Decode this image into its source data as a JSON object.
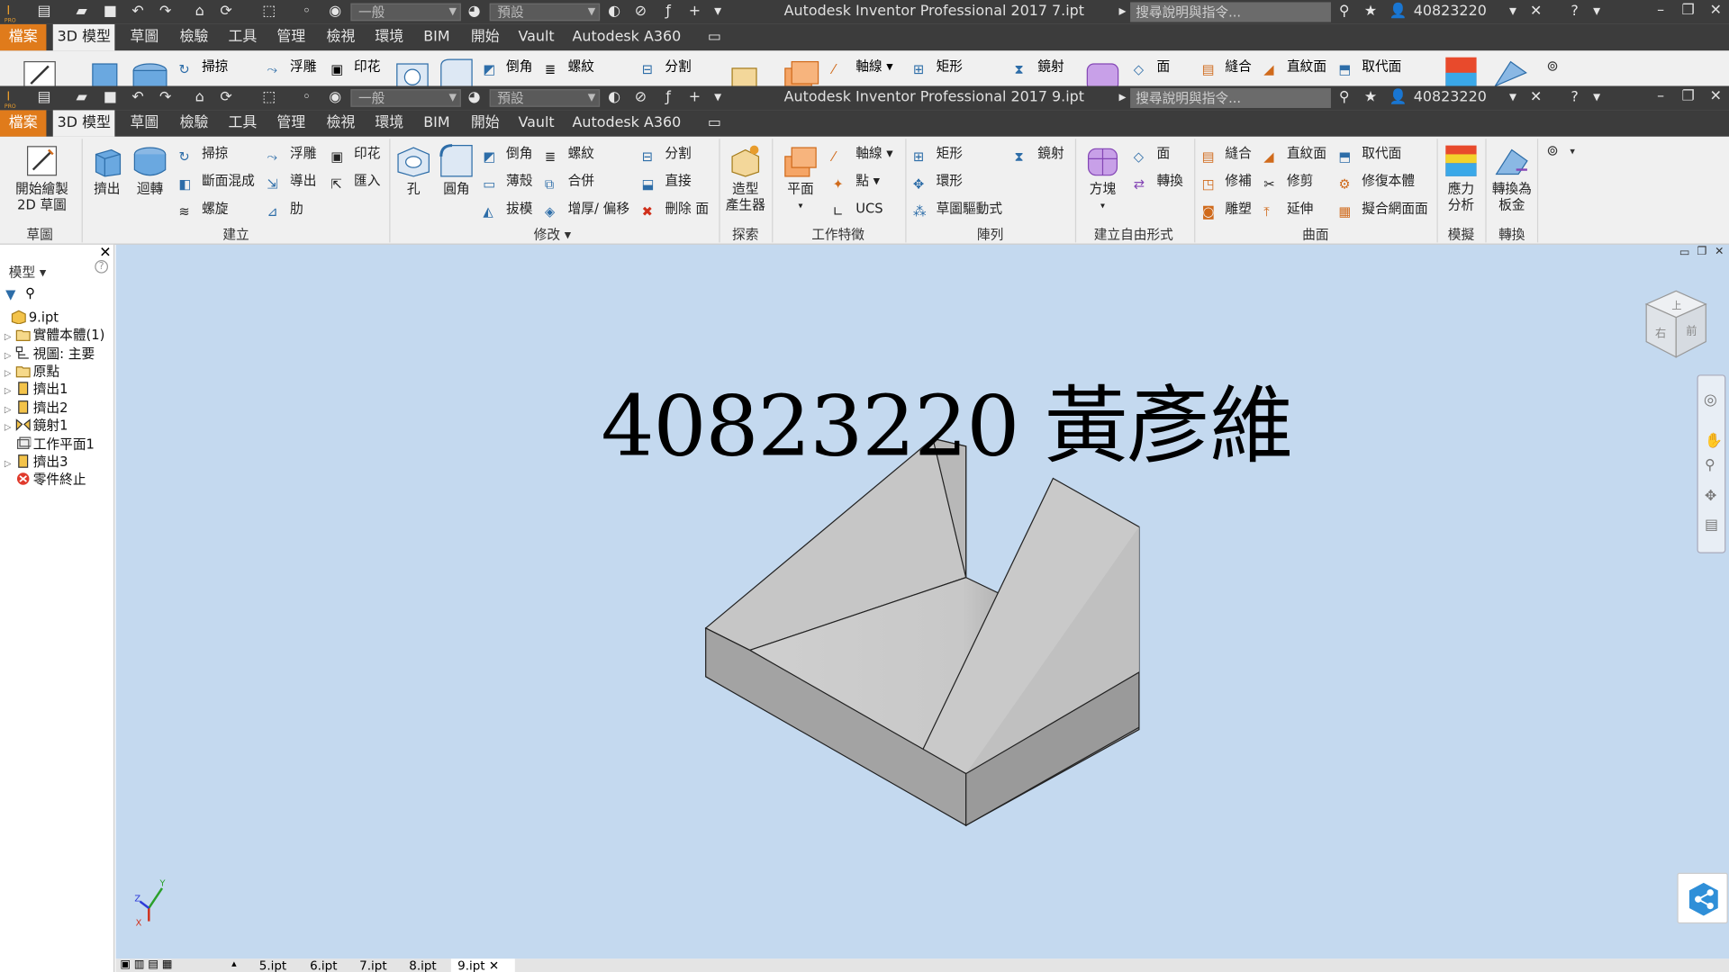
{
  "titlebar_back": {
    "search_placeholder": "搜尋說明與指令...",
    "style_dropdown": "一般",
    "material_dropdown": "預設",
    "title": "Autodesk Inventor Professional 2017    7.ipt",
    "user": "40823220"
  },
  "titlebar_front": {
    "search_placeholder": "搜尋說明與指令...",
    "style_dropdown": "一般",
    "material_dropdown": "預設",
    "title": "Autodesk Inventor Professional 2017    9.ipt",
    "user": "40823220"
  },
  "menu_tabs": [
    "檔案",
    "3D 模型",
    "草圖",
    "檢驗",
    "工具",
    "管理",
    "檢視",
    "環境",
    "BIM",
    "開始",
    "Vault",
    "Autodesk A360"
  ],
  "ribbon_back_strip": {
    "sweep": "掃掠",
    "emboss": "浮雕",
    "decal": "印花",
    "chamfer": "倒角",
    "thread": "螺紋",
    "split": "分割",
    "axis": "軸線",
    "rectangular": "矩形",
    "mirror": "鏡射",
    "face": "面",
    "stitch": "縫合",
    "ruled_surface": "直紋面",
    "replace_face": "取代面"
  },
  "ribbon": {
    "start_sketch": "開始繪製\n2D 草圖",
    "extrude": "擠出",
    "revolve": "迴轉",
    "sweep": "掃掠",
    "loft": "斷面混成",
    "coil": "螺旋",
    "emboss": "浮雕",
    "derive": "導出",
    "rib": "肋",
    "decal": "印花",
    "import": "匯入",
    "hole": "孔",
    "fillet": "圓角",
    "chamfer": "倒角",
    "shell": "薄殼",
    "draft": "拔模",
    "thread": "螺紋",
    "combine": "合併",
    "thicken": "增厚/ 偏移",
    "split": "分割",
    "direct": "直接",
    "delete_face": "刪除 面",
    "shape_generator": "造型\n產生器",
    "plane": "平面",
    "axis": "軸線",
    "point": "點",
    "ucs": "UCS",
    "rectangular": "矩形",
    "circular": "環形",
    "sketch_driven": "草圖驅動式",
    "mirror": "鏡射",
    "box": "方塊",
    "face": "面",
    "convert": "轉換",
    "stitch": "縫合",
    "patch": "修補",
    "sculpt": "雕塑",
    "ruled_surface": "直紋面",
    "trim": "修剪",
    "extend": "延伸",
    "replace_face": "取代面",
    "repair_bodies": "修復本體",
    "fit_mesh_face": "擬合網面面",
    "stress_analysis": "應力\n分析",
    "convert_sheet_metal": "轉換為\n板金",
    "panels": {
      "sketch": "草圖",
      "create": "建立",
      "modify": "修改",
      "explore": "探索",
      "work_features": "工作特徵",
      "pattern": "陣列",
      "create_freeform": "建立自由形式",
      "surface": "曲面",
      "simulation": "模擬",
      "convert": "轉換"
    }
  },
  "browser": {
    "header": "模型",
    "items": [
      {
        "label": "9.ipt",
        "expandable": false,
        "indent": 1
      },
      {
        "label": "實體本體(1)",
        "expandable": true,
        "indent": 0
      },
      {
        "label": "視圖: 主要",
        "expandable": true,
        "indent": 0
      },
      {
        "label": "原點",
        "expandable": true,
        "indent": 0
      },
      {
        "label": "擠出1",
        "expandable": true,
        "indent": 0
      },
      {
        "label": "擠出2",
        "expandable": true,
        "indent": 0
      },
      {
        "label": "鏡射1",
        "expandable": true,
        "indent": 0
      },
      {
        "label": "工作平面1",
        "expandable": false,
        "indent": 0
      },
      {
        "label": "擠出3",
        "expandable": true,
        "indent": 0
      },
      {
        "label": "零件終止",
        "expandable": false,
        "indent": 0
      }
    ]
  },
  "viewport": {
    "overlay_text": "40823220 黃彥維",
    "viewcube_labels": [
      "上",
      "右",
      "前"
    ]
  },
  "doc_tabs": [
    "5.ipt",
    "6.ipt",
    "7.ipt",
    "8.ipt",
    "9.ipt"
  ],
  "colors": {
    "titlebar_bg": "#3c3c3c",
    "file_tab": "#e07b1b",
    "ribbon_bg": "#f0f0f0",
    "viewport_bg": "#c4d9ef",
    "model_face_top": "#c9c9c9",
    "model_face_side": "#9d9d9d"
  }
}
